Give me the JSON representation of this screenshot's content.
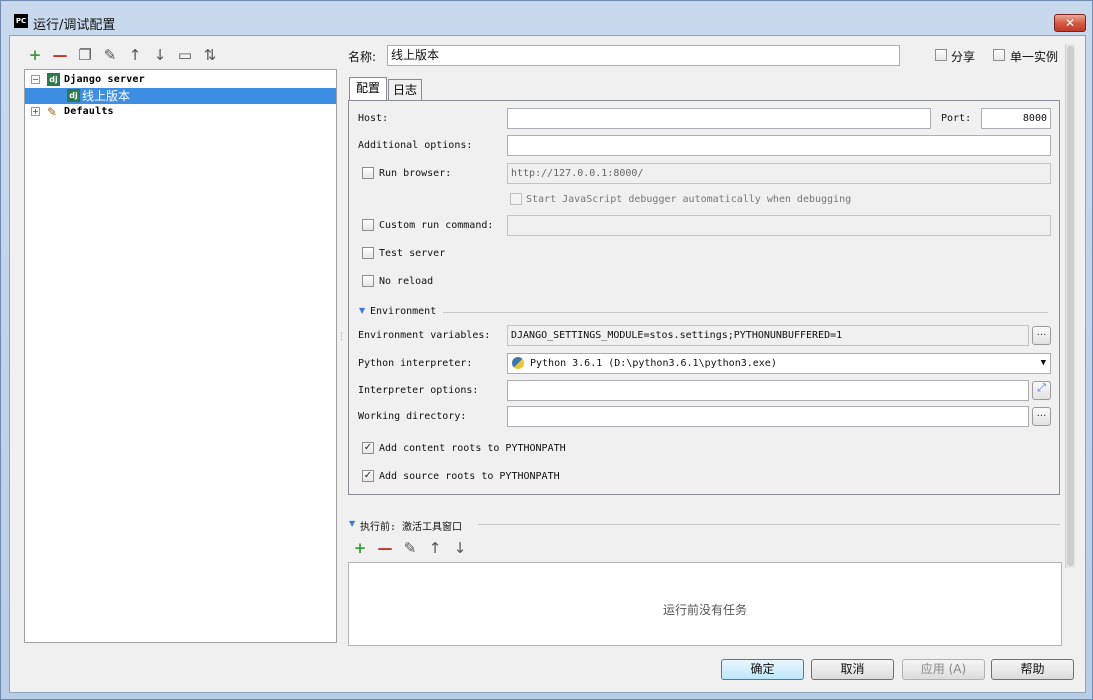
{
  "window": {
    "title": "运行/调试配置",
    "app_icon": "PC",
    "close_glyph": "✕"
  },
  "toolbar": [
    {
      "name": "add-icon",
      "glyph": "+"
    },
    {
      "name": "remove-icon",
      "glyph": "—"
    },
    {
      "name": "copy-icon",
      "glyph": "❐"
    },
    {
      "name": "wrench-icon",
      "glyph": "✎"
    },
    {
      "name": "move-up-icon",
      "glyph": "↑"
    },
    {
      "name": "move-down-icon",
      "glyph": "↓"
    },
    {
      "name": "folder-icon",
      "glyph": "▭"
    },
    {
      "name": "sort-icon",
      "glyph": "⇅"
    }
  ],
  "tree": {
    "django_server": "Django server",
    "selected_item": "线上版本",
    "defaults": "Defaults",
    "dj_icon": "dj"
  },
  "form": {
    "name_label": "名称:",
    "name_value": "线上版本",
    "share_label": "分享",
    "single_instance_label": "单一实例",
    "tabs": {
      "config": "配置",
      "logs": "日志"
    },
    "host_label": "Host:",
    "host_value": "",
    "port_label": "Port:",
    "port_value": "8000",
    "additional_options_label": "Additional options:",
    "run_browser_label": "Run browser:",
    "run_browser_url": "http://127.0.0.1:8000/",
    "js_debugger_label": "Start JavaScript debugger automatically when debugging",
    "custom_run_command_label": "Custom run command:",
    "test_server_label": "Test server",
    "no_reload_label": "No reload",
    "environment_section": "Environment",
    "env_vars_label": "Environment variables:",
    "env_vars_value": "DJANGO_SETTINGS_MODULE=stos.settings;PYTHONUNBUFFERED=1",
    "python_interpreter_label": "Python interpreter:",
    "python_interpreter_value": "Python 3.6.1 (D:\\python3.6.1\\python3.exe)",
    "interpreter_options_label": "Interpreter options:",
    "working_directory_label": "Working directory:",
    "add_content_roots_label": "Add content roots to PYTHONPATH",
    "add_source_roots_label": "Add source roots to PYTHONPATH",
    "browse_glyph": "...",
    "expand_glyph": "⤢"
  },
  "before_launch": {
    "title": "执行前: 激活工具窗口",
    "empty_text": "运行前没有任务",
    "toolbar": [
      {
        "name": "add-task-icon",
        "glyph": "+"
      },
      {
        "name": "remove-task-icon",
        "glyph": "—"
      },
      {
        "name": "edit-task-icon",
        "glyph": "✎"
      },
      {
        "name": "move-task-up-icon",
        "glyph": "↑"
      },
      {
        "name": "move-task-down-icon",
        "glyph": "↓"
      }
    ]
  },
  "buttons": {
    "ok": "确定",
    "cancel": "取消",
    "apply": "应用 (A)",
    "help": "帮助"
  },
  "colors": {
    "selection": "#3d8de3",
    "django_green": "#2c7a4b",
    "add_green": "#3c9a3c",
    "remove_red": "#c0392b"
  }
}
